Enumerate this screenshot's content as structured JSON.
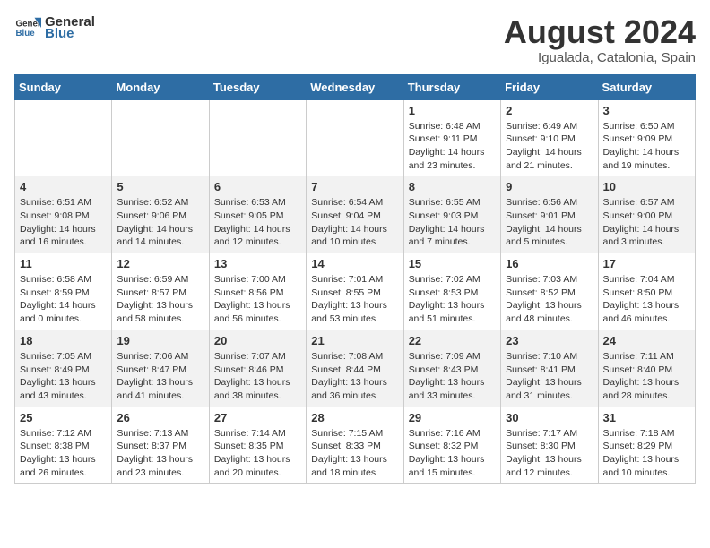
{
  "header": {
    "logo_general": "General",
    "logo_blue": "Blue",
    "title": "August 2024",
    "subtitle": "Igualada, Catalonia, Spain"
  },
  "weekdays": [
    "Sunday",
    "Monday",
    "Tuesday",
    "Wednesday",
    "Thursday",
    "Friday",
    "Saturday"
  ],
  "weeks": [
    [
      {
        "day": "",
        "info": ""
      },
      {
        "day": "",
        "info": ""
      },
      {
        "day": "",
        "info": ""
      },
      {
        "day": "",
        "info": ""
      },
      {
        "day": "1",
        "info": "Sunrise: 6:48 AM\nSunset: 9:11 PM\nDaylight: 14 hours\nand 23 minutes."
      },
      {
        "day": "2",
        "info": "Sunrise: 6:49 AM\nSunset: 9:10 PM\nDaylight: 14 hours\nand 21 minutes."
      },
      {
        "day": "3",
        "info": "Sunrise: 6:50 AM\nSunset: 9:09 PM\nDaylight: 14 hours\nand 19 minutes."
      }
    ],
    [
      {
        "day": "4",
        "info": "Sunrise: 6:51 AM\nSunset: 9:08 PM\nDaylight: 14 hours\nand 16 minutes."
      },
      {
        "day": "5",
        "info": "Sunrise: 6:52 AM\nSunset: 9:06 PM\nDaylight: 14 hours\nand 14 minutes."
      },
      {
        "day": "6",
        "info": "Sunrise: 6:53 AM\nSunset: 9:05 PM\nDaylight: 14 hours\nand 12 minutes."
      },
      {
        "day": "7",
        "info": "Sunrise: 6:54 AM\nSunset: 9:04 PM\nDaylight: 14 hours\nand 10 minutes."
      },
      {
        "day": "8",
        "info": "Sunrise: 6:55 AM\nSunset: 9:03 PM\nDaylight: 14 hours\nand 7 minutes."
      },
      {
        "day": "9",
        "info": "Sunrise: 6:56 AM\nSunset: 9:01 PM\nDaylight: 14 hours\nand 5 minutes."
      },
      {
        "day": "10",
        "info": "Sunrise: 6:57 AM\nSunset: 9:00 PM\nDaylight: 14 hours\nand 3 minutes."
      }
    ],
    [
      {
        "day": "11",
        "info": "Sunrise: 6:58 AM\nSunset: 8:59 PM\nDaylight: 14 hours\nand 0 minutes."
      },
      {
        "day": "12",
        "info": "Sunrise: 6:59 AM\nSunset: 8:57 PM\nDaylight: 13 hours\nand 58 minutes."
      },
      {
        "day": "13",
        "info": "Sunrise: 7:00 AM\nSunset: 8:56 PM\nDaylight: 13 hours\nand 56 minutes."
      },
      {
        "day": "14",
        "info": "Sunrise: 7:01 AM\nSunset: 8:55 PM\nDaylight: 13 hours\nand 53 minutes."
      },
      {
        "day": "15",
        "info": "Sunrise: 7:02 AM\nSunset: 8:53 PM\nDaylight: 13 hours\nand 51 minutes."
      },
      {
        "day": "16",
        "info": "Sunrise: 7:03 AM\nSunset: 8:52 PM\nDaylight: 13 hours\nand 48 minutes."
      },
      {
        "day": "17",
        "info": "Sunrise: 7:04 AM\nSunset: 8:50 PM\nDaylight: 13 hours\nand 46 minutes."
      }
    ],
    [
      {
        "day": "18",
        "info": "Sunrise: 7:05 AM\nSunset: 8:49 PM\nDaylight: 13 hours\nand 43 minutes."
      },
      {
        "day": "19",
        "info": "Sunrise: 7:06 AM\nSunset: 8:47 PM\nDaylight: 13 hours\nand 41 minutes."
      },
      {
        "day": "20",
        "info": "Sunrise: 7:07 AM\nSunset: 8:46 PM\nDaylight: 13 hours\nand 38 minutes."
      },
      {
        "day": "21",
        "info": "Sunrise: 7:08 AM\nSunset: 8:44 PM\nDaylight: 13 hours\nand 36 minutes."
      },
      {
        "day": "22",
        "info": "Sunrise: 7:09 AM\nSunset: 8:43 PM\nDaylight: 13 hours\nand 33 minutes."
      },
      {
        "day": "23",
        "info": "Sunrise: 7:10 AM\nSunset: 8:41 PM\nDaylight: 13 hours\nand 31 minutes."
      },
      {
        "day": "24",
        "info": "Sunrise: 7:11 AM\nSunset: 8:40 PM\nDaylight: 13 hours\nand 28 minutes."
      }
    ],
    [
      {
        "day": "25",
        "info": "Sunrise: 7:12 AM\nSunset: 8:38 PM\nDaylight: 13 hours\nand 26 minutes."
      },
      {
        "day": "26",
        "info": "Sunrise: 7:13 AM\nSunset: 8:37 PM\nDaylight: 13 hours\nand 23 minutes."
      },
      {
        "day": "27",
        "info": "Sunrise: 7:14 AM\nSunset: 8:35 PM\nDaylight: 13 hours\nand 20 minutes."
      },
      {
        "day": "28",
        "info": "Sunrise: 7:15 AM\nSunset: 8:33 PM\nDaylight: 13 hours\nand 18 minutes."
      },
      {
        "day": "29",
        "info": "Sunrise: 7:16 AM\nSunset: 8:32 PM\nDaylight: 13 hours\nand 15 minutes."
      },
      {
        "day": "30",
        "info": "Sunrise: 7:17 AM\nSunset: 8:30 PM\nDaylight: 13 hours\nand 12 minutes."
      },
      {
        "day": "31",
        "info": "Sunrise: 7:18 AM\nSunset: 8:29 PM\nDaylight: 13 hours\nand 10 minutes."
      }
    ]
  ]
}
